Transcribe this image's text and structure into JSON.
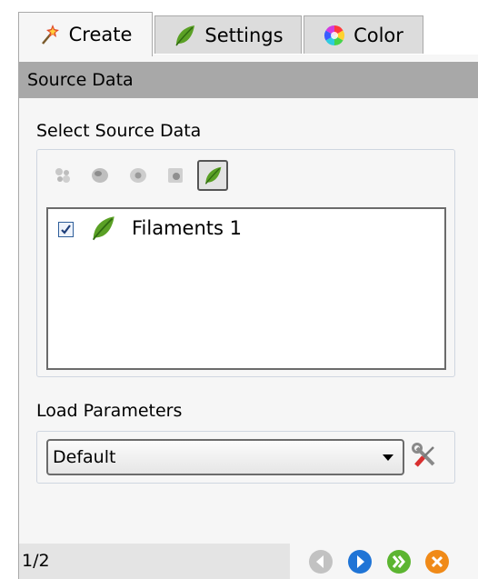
{
  "tabs": [
    {
      "label": "Create",
      "icon": "magic-wand-icon",
      "active": true
    },
    {
      "label": "Settings",
      "icon": "leaf-icon",
      "active": false
    },
    {
      "label": "Color",
      "icon": "color-wheel-icon",
      "active": false
    }
  ],
  "section_header": "Source Data",
  "source": {
    "label": "Select Source Data",
    "buttons": [
      {
        "icon": "spots-source-icon",
        "active": false
      },
      {
        "icon": "surface-source-icon",
        "active": false
      },
      {
        "icon": "cells-source-icon",
        "active": false
      },
      {
        "icon": "volume-source-icon",
        "active": false
      },
      {
        "icon": "filaments-source-icon",
        "active": true
      }
    ],
    "items": [
      {
        "label": "Filaments 1",
        "checked": true,
        "icon": "leaf-icon"
      }
    ]
  },
  "load_parameters": {
    "label": "Load Parameters",
    "selected": "Default",
    "tool_icon": "wrench-screwdriver-icon"
  },
  "footer": {
    "page": "1/2",
    "buttons": [
      "back-icon",
      "next-icon",
      "finish-icon",
      "cancel-icon"
    ]
  },
  "colors": {
    "header_bg": "#a8a8a8",
    "panel_bg": "#f6f6f6",
    "leaf_green": "#5aa025",
    "next_blue": "#1f74d6",
    "finish_green": "#5cb531",
    "cancel_orange": "#f08a18"
  }
}
